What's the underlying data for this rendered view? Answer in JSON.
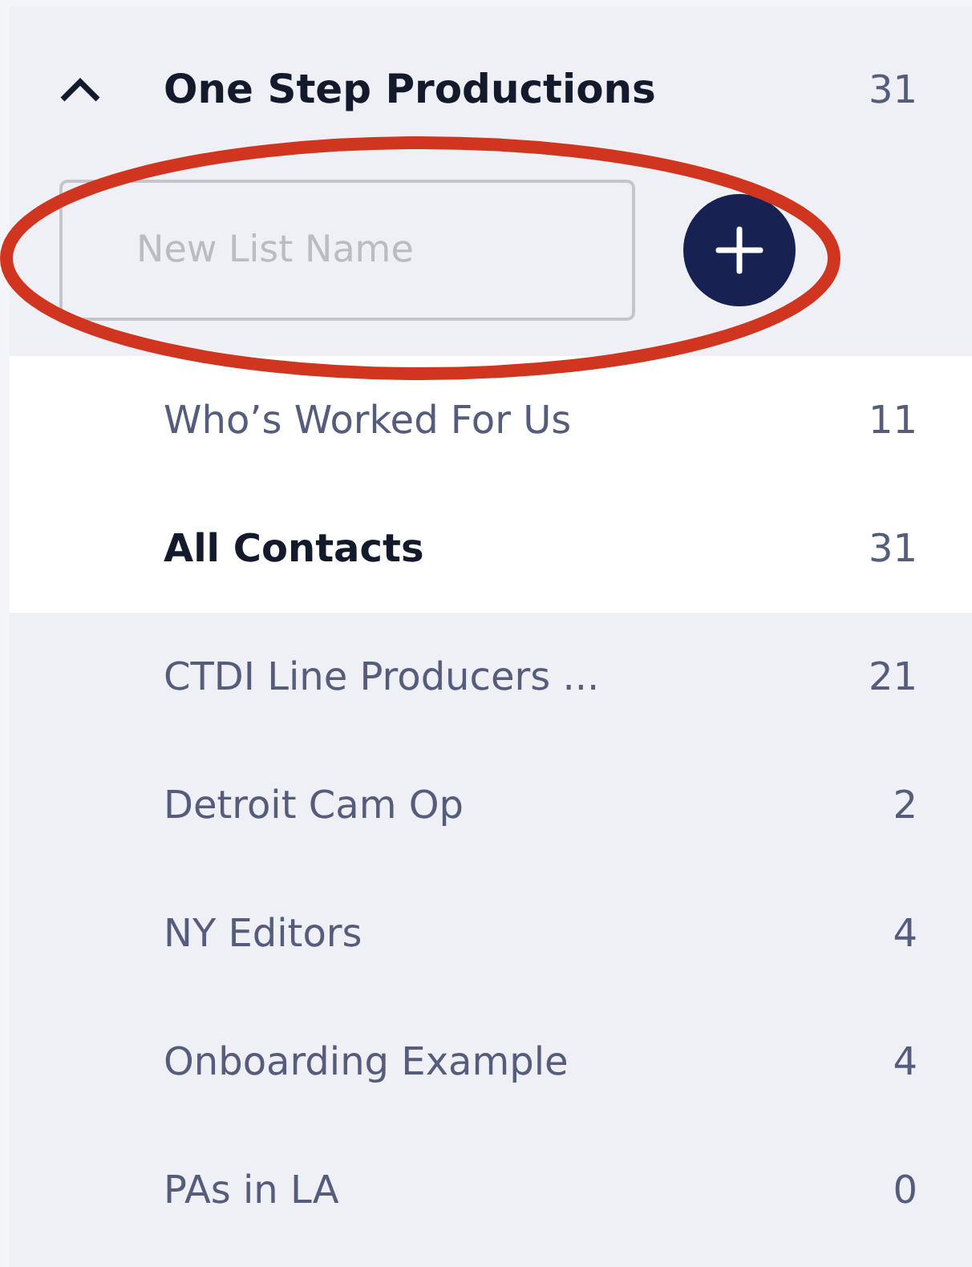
{
  "group": {
    "name": "One Step Productions",
    "count": "31",
    "expanded": true
  },
  "new_list": {
    "placeholder": "New List Name"
  },
  "annotation": {
    "kind": "ellipse"
  },
  "lists": [
    {
      "name": "Who’s Worked For Us",
      "count": "11",
      "highlighted": true,
      "selected": false
    },
    {
      "name": "All Contacts",
      "count": "31",
      "highlighted": true,
      "selected": true
    },
    {
      "name": "CTDI Line Producers ...",
      "count": "21",
      "highlighted": false,
      "selected": false
    },
    {
      "name": "Detroit Cam Op",
      "count": "2",
      "highlighted": false,
      "selected": false
    },
    {
      "name": "NY Editors",
      "count": "4",
      "highlighted": false,
      "selected": false
    },
    {
      "name": "Onboarding Example",
      "count": "4",
      "highlighted": false,
      "selected": false
    },
    {
      "name": "PAs in LA",
      "count": "0",
      "highlighted": false,
      "selected": false
    }
  ]
}
